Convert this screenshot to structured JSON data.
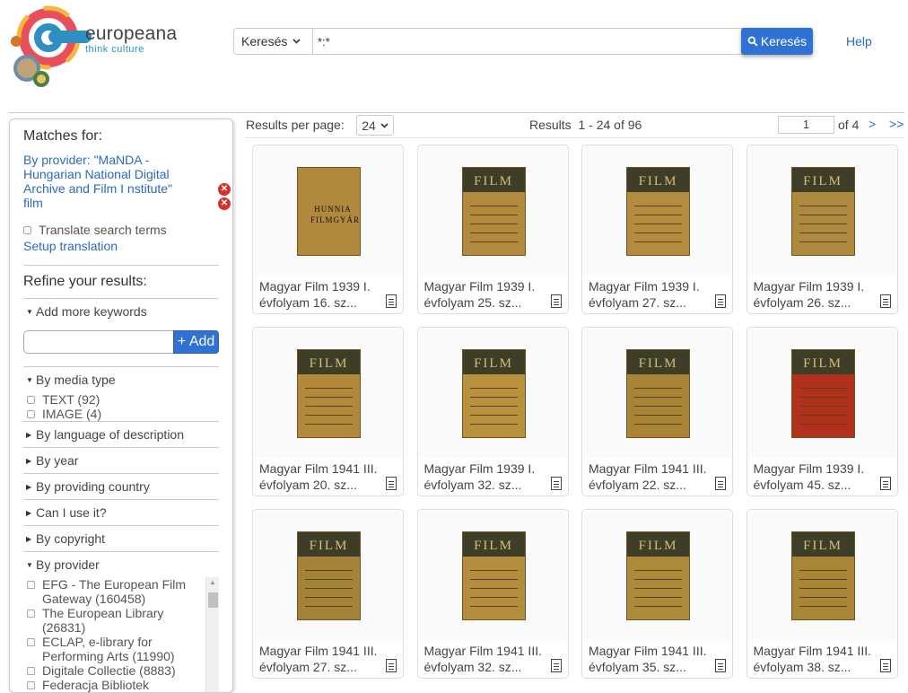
{
  "brand": {
    "name": "europeana",
    "tagline": "think culture"
  },
  "search": {
    "type_label": "Keresés",
    "query": "*:*",
    "button_label": "Keresés"
  },
  "help_label": "Help",
  "sidebar": {
    "matches_title": "Matches for:",
    "matches": [
      "By provider: \"MaNDA - Hungarian National Digital Archive and Film I nstitute\"",
      "film"
    ],
    "translate_label": "Translate search terms",
    "setup_translation": "Setup translation",
    "refine_title": "Refine your results:",
    "add_keywords": "Add more keywords",
    "add_button": "+ Add",
    "media_type": {
      "label": "By media type",
      "options": [
        "TEXT (92)",
        "IMAGE (4)"
      ]
    },
    "facets": [
      "By language of description",
      "By year",
      "By providing country",
      "Can I use it?",
      "By copyright"
    ],
    "provider": {
      "label": "By provider",
      "options": [
        "EFG - The European Film Gateway (160458)",
        "The European Library (26831)",
        "ECLAP, e-library for Performing Arts (11990)",
        "Digitale Collectie (8883)",
        "Federacja Bibliotek"
      ]
    }
  },
  "results": {
    "per_page_label": "Results per page:",
    "per_page": "24",
    "results_label": "Results",
    "range": "1 - 24 of 96",
    "page": "1",
    "of_pages": "of 4",
    "next": ">",
    "last": ">>"
  },
  "items": [
    {
      "line1": "Magyar Film 1939 I.",
      "line2": "évfolyam 16. sz...",
      "cover": "HUNNIA FILMGYÁR",
      "cover_color": "#b0893d"
    },
    {
      "line1": "Magyar Film 1939 I.",
      "line2": "évfolyam 25. sz...",
      "cover": "FILM",
      "cover_color": "#b18a3e"
    },
    {
      "line1": "Magyar Film 1939 I.",
      "line2": "évfolyam 27. sz...",
      "cover": "FILM",
      "cover_color": "#b48c3f"
    },
    {
      "line1": "Magyar Film 1939 I.",
      "line2": "évfolyam 26. sz...",
      "cover": "FILM",
      "cover_color": "#ae8a40"
    },
    {
      "line1": "Magyar Film 1941 III.",
      "line2": "évfolyam 20. sz...",
      "cover": "FILM",
      "cover_color": "#b08a3a"
    },
    {
      "line1": "Magyar Film 1939 I.",
      "line2": "évfolyam 32. sz...",
      "cover": "FILM",
      "cover_color": "#b8913f"
    },
    {
      "line1": "Magyar Film 1941 III.",
      "line2": "évfolyam 22. sz...",
      "cover": "FILM",
      "cover_color": "#a98437"
    },
    {
      "line1": "Magyar Film 1939 I.",
      "line2": "évfolyam 45. sz...",
      "cover": "FILM",
      "cover_color": "#b2311c"
    },
    {
      "line1": "Magyar Film 1941 III.",
      "line2": "évfolyam 27. sz...",
      "cover": "FILM",
      "cover_color": "#a48236"
    },
    {
      "line1": "Magyar Film 1941 III.",
      "line2": "évfolyam 32. sz...",
      "cover": "FILM",
      "cover_color": "#b48d3f"
    },
    {
      "line1": "Magyar Film 1941 III.",
      "line2": "évfolyam 35. sz...",
      "cover": "FILM",
      "cover_color": "#ad8a3b"
    },
    {
      "line1": "Magyar Film 1941 III.",
      "line2": "évfolyam 38. sz...",
      "cover": "FILM",
      "cover_color": "#a88537"
    }
  ],
  "icons": {
    "search": "search-icon",
    "remove": "remove-filter-icon",
    "document": "document-icon",
    "chevron": "chevron-down-icon"
  }
}
